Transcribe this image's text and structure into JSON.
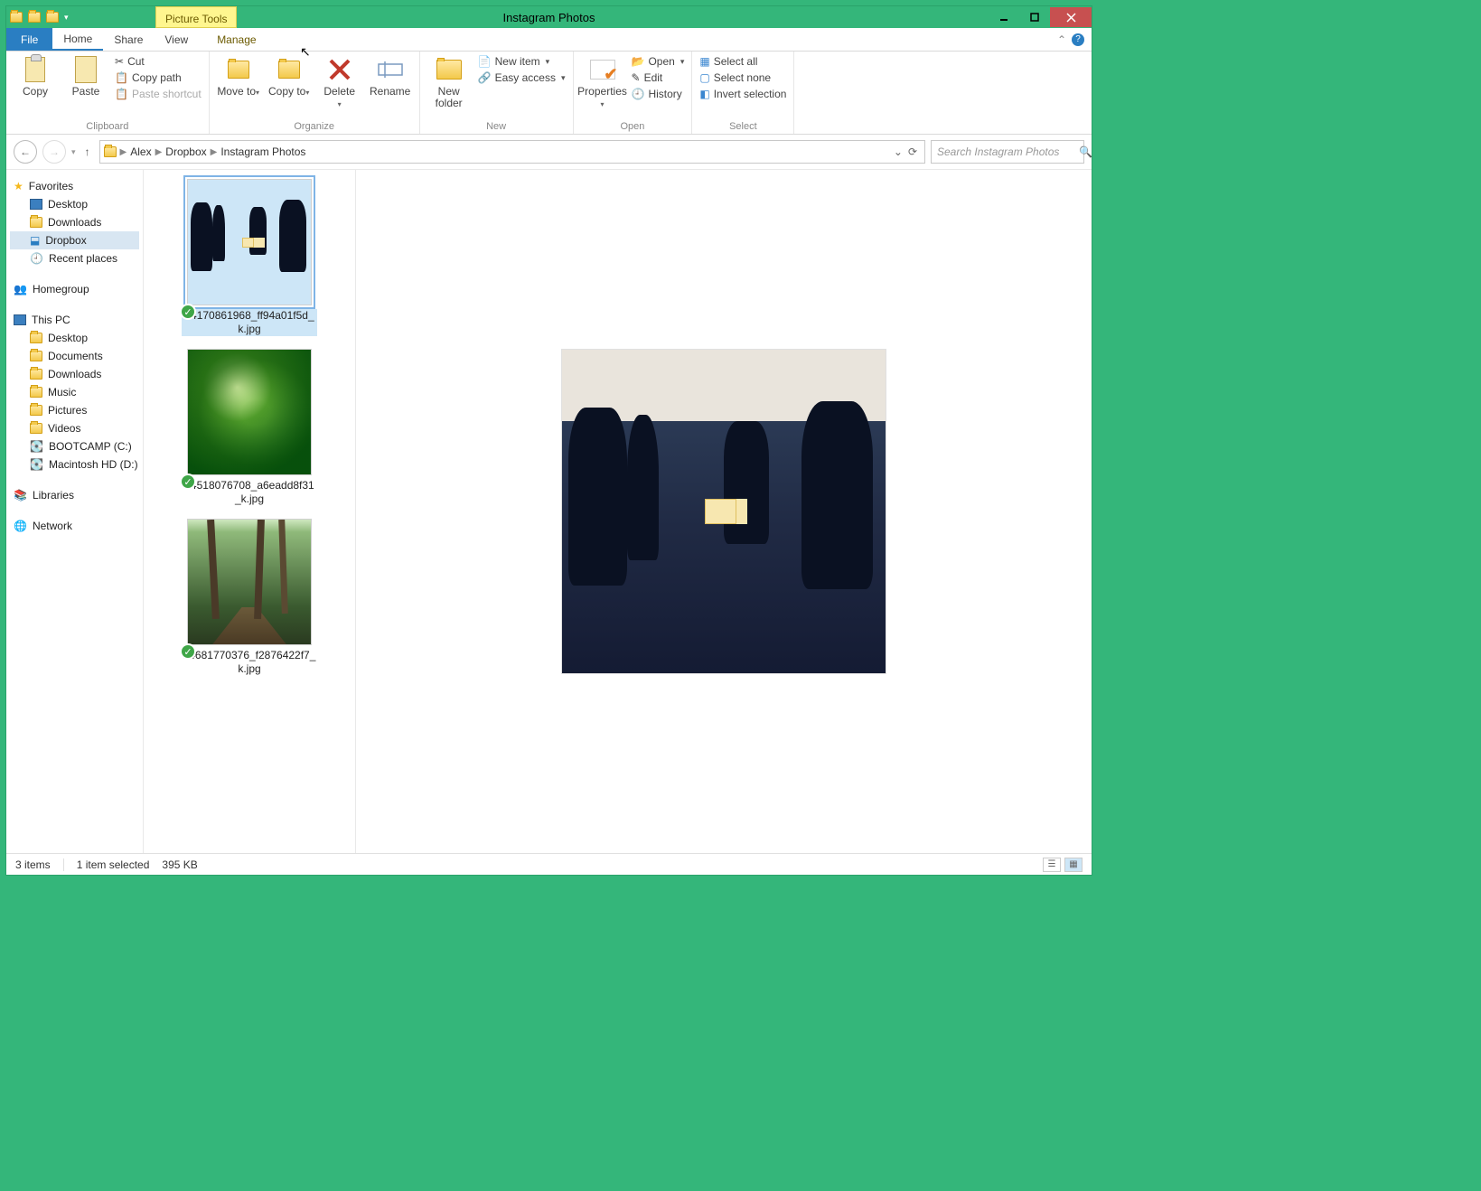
{
  "titlebar": {
    "picture_tools": "Picture Tools",
    "title": "Instagram Photos"
  },
  "tabs": {
    "file": "File",
    "home": "Home",
    "share": "Share",
    "view": "View",
    "manage": "Manage"
  },
  "ribbon": {
    "clipboard": {
      "copy": "Copy",
      "paste": "Paste",
      "cut": "Cut",
      "copy_path": "Copy path",
      "paste_shortcut": "Paste shortcut",
      "group": "Clipboard"
    },
    "organize": {
      "move_to": "Move to",
      "copy_to": "Copy to",
      "delete": "Delete",
      "rename": "Rename",
      "group": "Organize"
    },
    "new": {
      "new_folder": "New folder",
      "new_item": "New item",
      "easy_access": "Easy access",
      "group": "New"
    },
    "open": {
      "properties": "Properties",
      "open": "Open",
      "edit": "Edit",
      "history": "History",
      "group": "Open"
    },
    "select": {
      "select_all": "Select all",
      "select_none": "Select none",
      "invert": "Invert selection",
      "group": "Select"
    }
  },
  "breadcrumbs": {
    "b0": "Alex",
    "b1": "Dropbox",
    "b2": "Instagram Photos"
  },
  "search": {
    "placeholder": "Search Instagram Photos"
  },
  "nav": {
    "favorites": "Favorites",
    "desktop": "Desktop",
    "downloads": "Downloads",
    "dropbox": "Dropbox",
    "recent": "Recent places",
    "homegroup": "Homegroup",
    "this_pc": "This PC",
    "documents": "Documents",
    "music": "Music",
    "pictures": "Pictures",
    "videos": "Videos",
    "bootcamp": "BOOTCAMP (C:)",
    "mac": "Macintosh HD (D:)",
    "libraries": "Libraries",
    "network": "Network"
  },
  "files": {
    "f0": "14170861968_ff94a01f5d_k.jpg",
    "f1": "14518076708_a6eadd8f31_k.jpg",
    "f2": "14681770376_f2876422f7_k.jpg"
  },
  "status": {
    "count": "3 items",
    "selected": "1 item selected",
    "size": "395 KB"
  }
}
